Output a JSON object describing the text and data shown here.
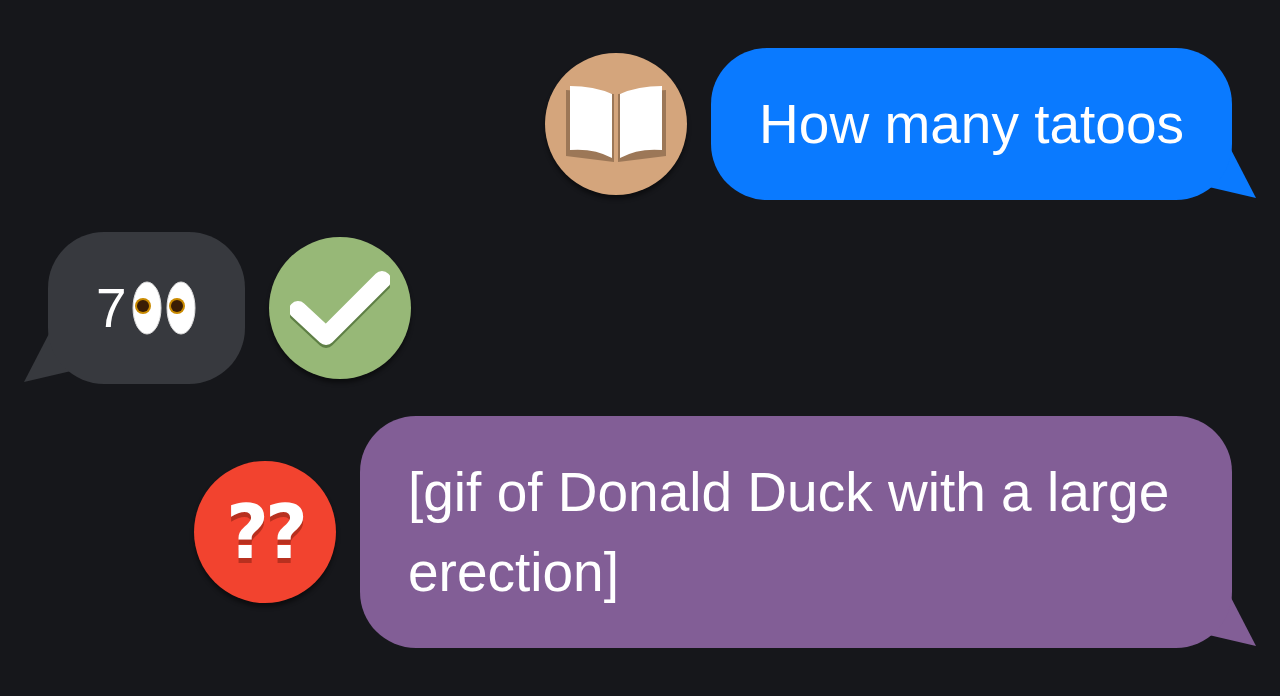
{
  "messages": [
    {
      "kind": "outgoing",
      "color": "#0a7aff",
      "text": "How many tatoos",
      "reaction": {
        "kind": "book"
      }
    },
    {
      "kind": "incoming",
      "color": "#37393e",
      "text": "7",
      "trailing_icon": {
        "kind": "eyes"
      },
      "reaction": {
        "kind": "check"
      }
    },
    {
      "kind": "outgoing",
      "color": "#825e96",
      "text": "[gif of Donald Duck with a large erection]",
      "reaction": {
        "kind": "question",
        "label": "??"
      }
    }
  ]
}
